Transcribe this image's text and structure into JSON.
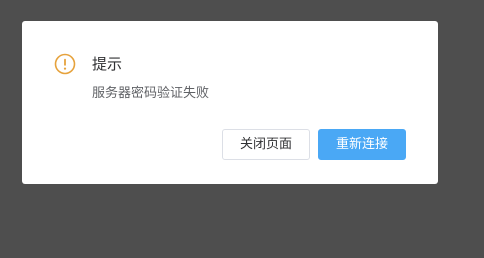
{
  "dialog": {
    "icon": "warning-circle-icon",
    "title": "提示",
    "message": "服务器密码验证失败",
    "buttons": {
      "close_label": "关闭页面",
      "reconnect_label": "重新连接"
    },
    "colors": {
      "overlay": "#4e4e4e",
      "warning": "#e6a23c",
      "primary": "#4aa8f5"
    }
  }
}
